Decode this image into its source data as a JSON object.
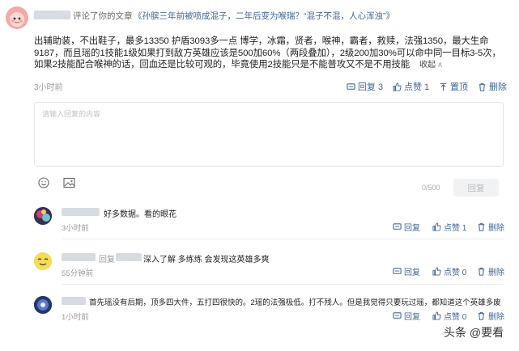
{
  "post": {
    "action_text": "评论了你的文章",
    "article_title": "《孙膑三年前被喷成混子，二年后变为喉瑞？“混子不混，人心浑浊”》",
    "body": "出辅助装，不出鞋子，最多13350 护盾3093多一点 博学，冰霜，贤者，喉神，霸者，救赎，法强1350，最大生命9187，而且瑶的1技能1级如果打到敌方英雄应该是500加60%（两段叠加），2级200加30%可以命中同一目标3-5次，如果2技能配合喉神的话，回血还是比较可观的，毕竟使用2技能只是不能普攻又不是不用技能",
    "collapse_label": "收起",
    "time": "3小时前",
    "reply_label": "回复 3",
    "like_label": "点赞 1",
    "pin_label": "置顶",
    "delete_label": "删除"
  },
  "reply_box": {
    "placeholder": "请输入回复的内容",
    "counter": "0/500",
    "submit_label": "回复"
  },
  "comments": [
    {
      "text": "好多数据。看的眼花",
      "time": "3小时前",
      "reply_label": "回复",
      "like_label": "点赞 1",
      "delete_label": "删除"
    },
    {
      "reply_word": "回复",
      "text": "深入了解 多练练 会发现这英雄多爽",
      "time": "55分钟前",
      "reply_label": "回复",
      "like_label": "点赞 0",
      "delete_label": "删除"
    },
    {
      "text": "首先瑶没有后期，顶多四大件，五打四很快的。2瑶的法强极低。打不残人。但是我觉得只要玩过瑶，都知道这个英雄多废",
      "time": "1小时前",
      "reply_label": "回复",
      "like_label": "点赞 0",
      "delete_label": "删除"
    }
  ],
  "watermark": "头条 @要看",
  "colors": {
    "link": "#406599",
    "muted": "#999999",
    "divider": "#eeeeee"
  }
}
